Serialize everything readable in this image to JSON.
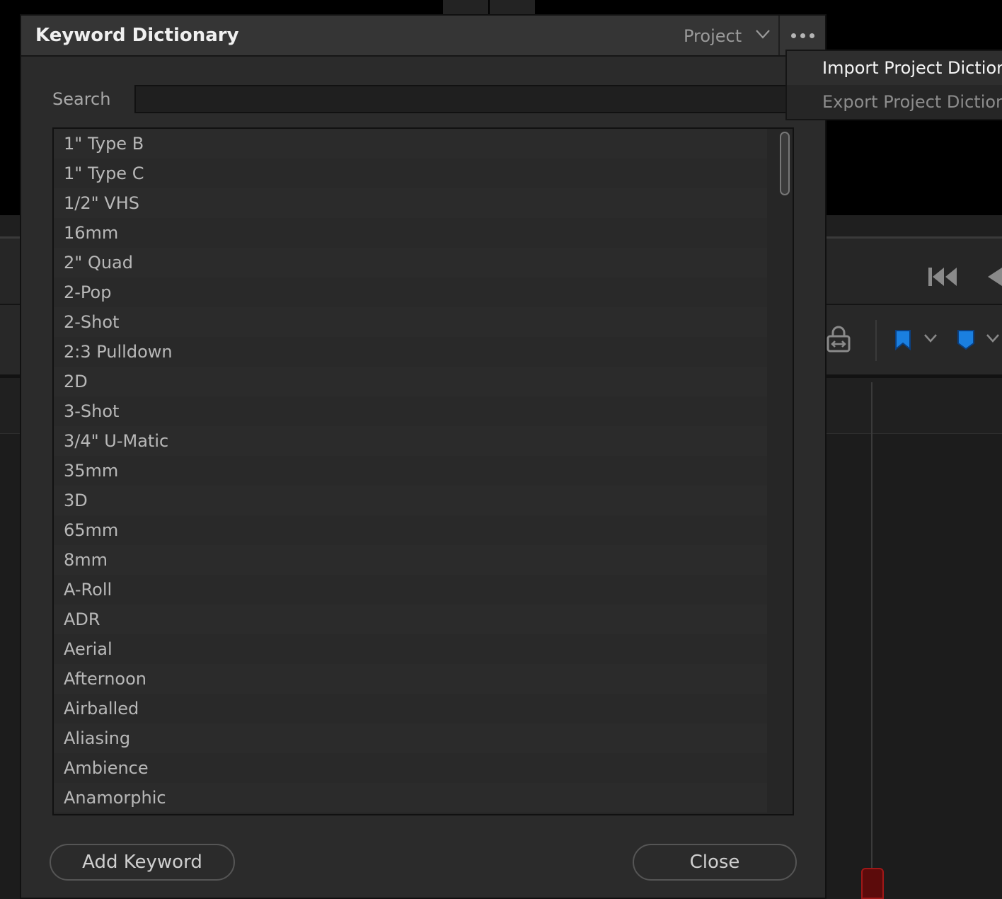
{
  "dialog": {
    "title": "Keyword Dictionary",
    "scope_selector": "Project",
    "search": {
      "label": "Search",
      "value": "",
      "placeholder": ""
    },
    "keywords": [
      "1\" Type B",
      "1\" Type C",
      "1/2\" VHS",
      "16mm",
      "2\" Quad",
      "2-Pop",
      "2-Shot",
      "2:3 Pulldown",
      "2D",
      "3-Shot",
      "3/4\" U-Matic",
      "35mm",
      "3D",
      "65mm",
      "8mm",
      "A-Roll",
      "ADR",
      "Aerial",
      "Afternoon",
      "Airballed",
      "Aliasing",
      "Ambience",
      "Anamorphic"
    ],
    "buttons": {
      "add": "Add Keyword",
      "close": "Close"
    }
  },
  "menu": {
    "items": [
      {
        "label": "Import Project Dictiona",
        "state": "active"
      },
      {
        "label": "Export Project Dictiona",
        "state": "dim"
      }
    ]
  },
  "icons": {
    "more": "more-options-icon",
    "scope_chevron": "chevron-down-icon",
    "skip_start": "skip-to-start-icon",
    "lock": "link-lock-icon",
    "flag": "flag-marker-icon",
    "marker": "marker-icon"
  },
  "colors": {
    "accent_blue": "#1a7fe0",
    "playhead_red": "#a01818"
  }
}
